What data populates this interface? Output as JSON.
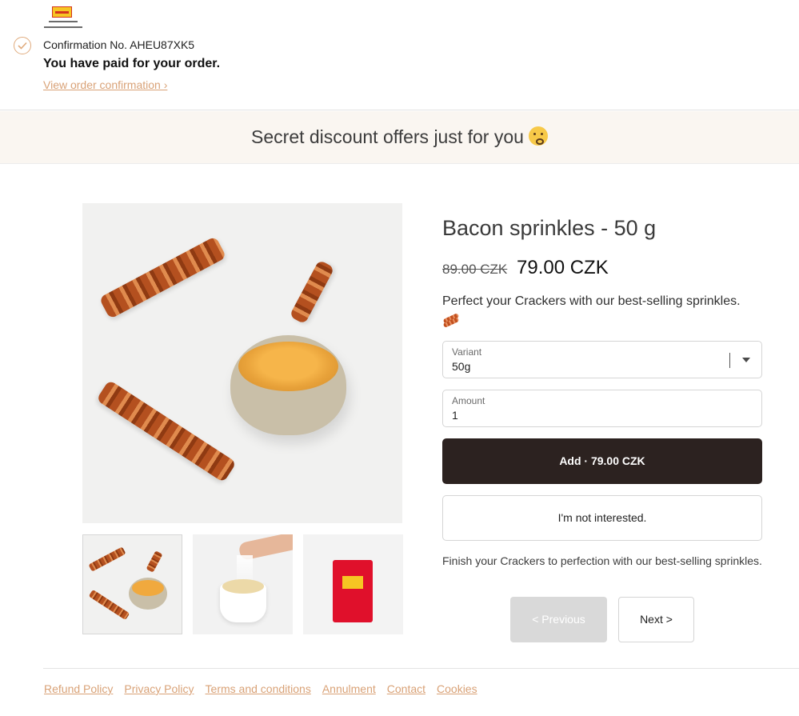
{
  "header": {
    "confirmation_number": "Confirmation No. AHEU87XK5",
    "paid_message": "You have paid for your order.",
    "view_confirmation_link": "View order confirmation ›",
    "accent_color": "#d9a277"
  },
  "banner": {
    "text": "Secret discount offers just for you",
    "emoji_icon": "shushing-face-icon"
  },
  "product": {
    "title": "Bacon sprinkles - 50 g",
    "old_price": "89.00 CZK",
    "new_price": "79.00 CZK",
    "description": "Perfect your Crackers with our best-selling sprinkles.",
    "description_icon": "bacon-icon",
    "variant": {
      "label": "Variant",
      "value": "50g"
    },
    "amount": {
      "label": "Amount",
      "value": "1"
    },
    "add_button": "Add · 79.00 CZK",
    "decline_button": "I'm not interested.",
    "finish_text": "Finish your Crackers to perfection with our best-selling sprinkles.",
    "thumbnails": [
      {
        "name": "bacon-and-bowl"
      },
      {
        "name": "hand-sprinkling-crackers"
      },
      {
        "name": "red-package"
      }
    ]
  },
  "pagination": {
    "previous": "< Previous",
    "next": "Next >"
  },
  "footer": {
    "links": [
      "Refund Policy",
      "Privacy Policy",
      "Terms and conditions",
      "Annulment",
      "Contact",
      "Cookies"
    ]
  },
  "colors": {
    "primary_button": "#2c2220",
    "banner_bg": "#faf6f1",
    "disabled_button": "#d9d9d9"
  }
}
